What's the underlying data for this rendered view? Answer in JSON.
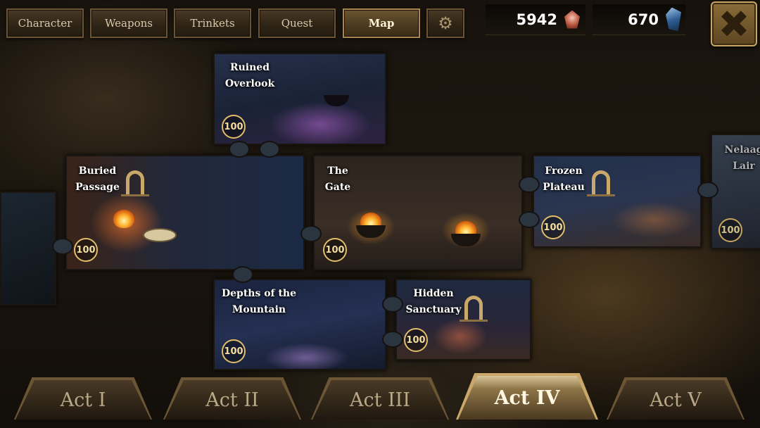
{
  "tabs": [
    {
      "label": "Character"
    },
    {
      "label": "Weapons"
    },
    {
      "label": "Trinkets"
    },
    {
      "label": "Quest"
    },
    {
      "label": "Map",
      "active": true
    }
  ],
  "currency": {
    "gems_red": "5942",
    "gems_blue": "670"
  },
  "map_pieces": [
    {
      "name": "Ruined\nOverlook",
      "score": "100"
    },
    {
      "name": "Buried\nPassage",
      "score": "100"
    },
    {
      "name": "The\nGate",
      "score": "100"
    },
    {
      "name": "Frozen\nPlateau",
      "score": "100"
    },
    {
      "name": "Nelaag\nLair",
      "score": "100"
    },
    {
      "name": "Depths of the\nMountain",
      "score": "100"
    },
    {
      "name": "Hidden\nSanctuary",
      "score": "100"
    }
  ],
  "acts": [
    {
      "label": "Act I"
    },
    {
      "label": "Act II"
    },
    {
      "label": "Act III"
    },
    {
      "label": "Act IV",
      "active": true
    },
    {
      "label": "Act V"
    }
  ],
  "colors": {
    "accent_gold": "#e2bd6a",
    "tab_text": "#d8c9a8"
  },
  "icons": {
    "settings": "gear-icon",
    "close": "close-icon",
    "currency_red": "red-gem-icon",
    "currency_blue": "blue-crystal-icon",
    "gate": "archway-icon"
  }
}
